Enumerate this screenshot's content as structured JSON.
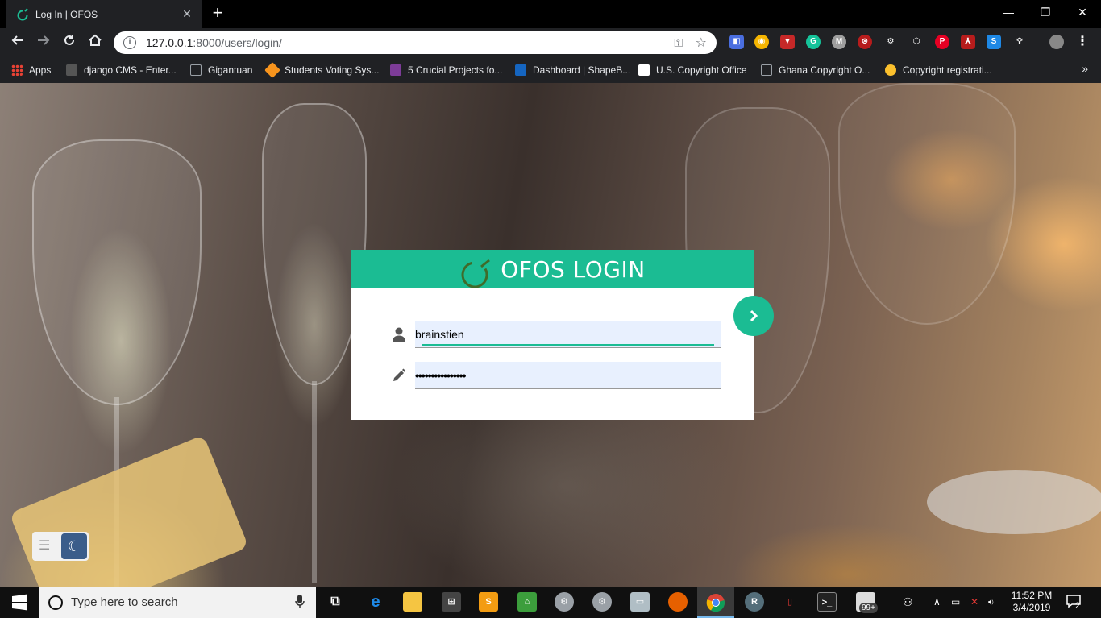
{
  "browser": {
    "tab_title": "Log In | OFOS",
    "tab_close": "✕",
    "new_tab": "+",
    "url_host": "127.0.0.1",
    "url_path": ":8000/users/login/",
    "window_minimize": "—",
    "window_restore": "❐",
    "window_close": "✕"
  },
  "bookmarks": [
    {
      "label": "Apps",
      "color": "#e94235"
    },
    {
      "label": "django CMS - Enter...",
      "color": "#555555"
    },
    {
      "label": "Gigantuan",
      "color": "#9aa0a6"
    },
    {
      "label": "Students Voting Sys...",
      "color": "#f7941d"
    },
    {
      "label": "5 Crucial Projects fo...",
      "color": "#7d3c98"
    },
    {
      "label": "Dashboard | ShapeB...",
      "color": "#1565c0"
    },
    {
      "label": "U.S. Copyright Office",
      "color": "#ffffff"
    },
    {
      "label": "Ghana Copyright O...",
      "color": "#9aa0a6"
    },
    {
      "label": "Copyright registrati...",
      "color": "#fbc02d"
    }
  ],
  "bookmarks_more": "»",
  "login": {
    "title": "OFOS LOGIN",
    "username_value": "brainstien",
    "password_value": "••••••••••••••••"
  },
  "taskbar": {
    "search_placeholder": "Type here to search",
    "time": "11:52 PM",
    "date": "3/4/2019",
    "badge_count": "99+",
    "notification_count": "2"
  },
  "colors": {
    "accent": "#1bbc93"
  }
}
